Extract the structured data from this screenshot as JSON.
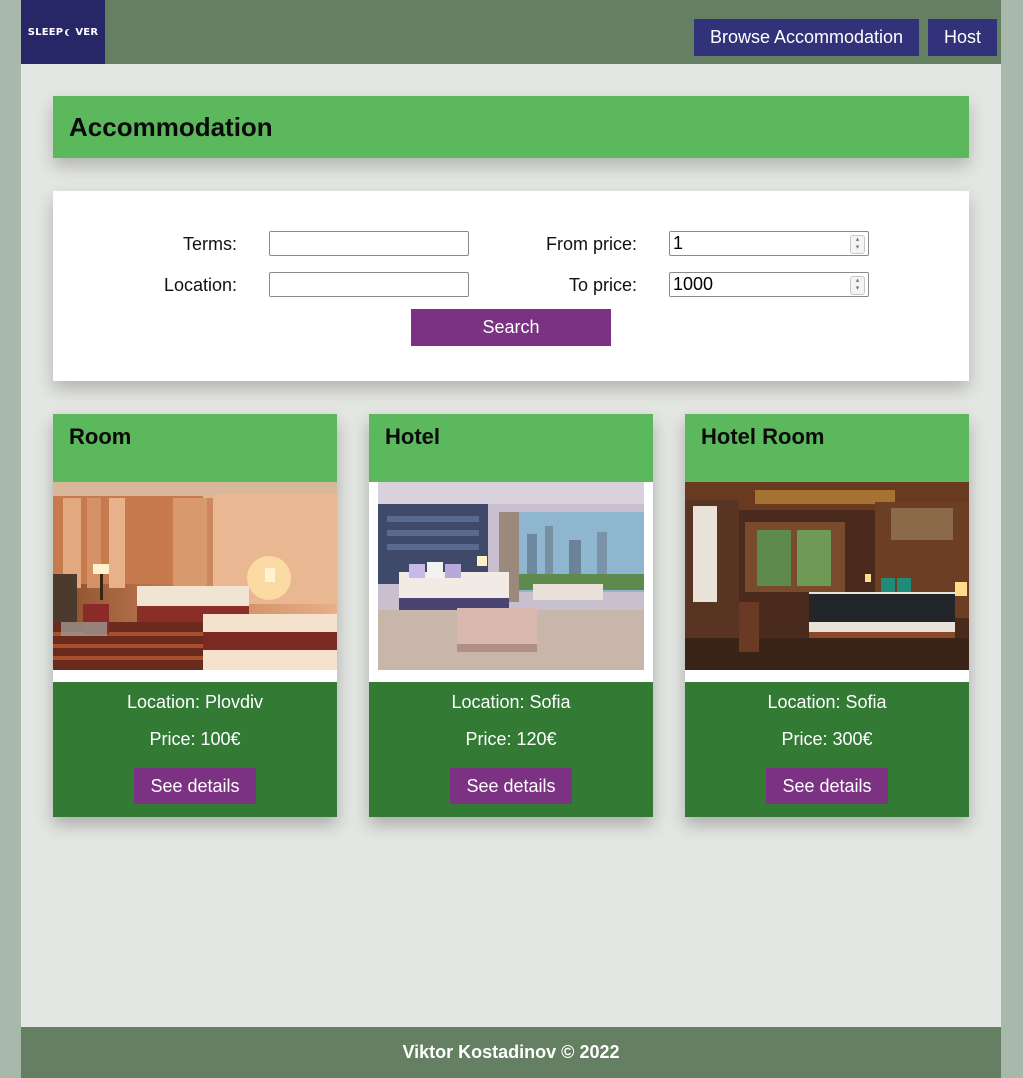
{
  "header": {
    "logo_text_left": "SLEEP",
    "logo_text_right": "VER",
    "nav": {
      "browse_label": "Browse Accommodation",
      "host_label": "Host"
    }
  },
  "main": {
    "title": "Accommodation",
    "search": {
      "terms_label": "Terms:",
      "terms_value": "",
      "location_label": "Location:",
      "location_value": "",
      "from_price_label": "From price:",
      "from_price_value": "1",
      "to_price_label": "To price:",
      "to_price_value": "1000",
      "search_label": "Search"
    },
    "listings": [
      {
        "title": "Room",
        "location": "Location: Plovdiv",
        "price": "Price: 100€",
        "button": "See details"
      },
      {
        "title": "Hotel",
        "location": "Location: Sofia",
        "price": "Price: 120€",
        "button": "See details"
      },
      {
        "title": "Hotel Room",
        "location": "Location: Sofia",
        "price": "Price: 300€",
        "button": "See details"
      }
    ]
  },
  "footer": {
    "text": "Viktor Kostadinov © 2022"
  },
  "colors": {
    "header_bg": "#657f63",
    "logo_bg": "#272768",
    "nav_button": "#32327a",
    "card_header": "#5cb85c",
    "card_body": "#337a35",
    "action_button": "#7c3282",
    "page_bg": "#e4e6e3"
  }
}
